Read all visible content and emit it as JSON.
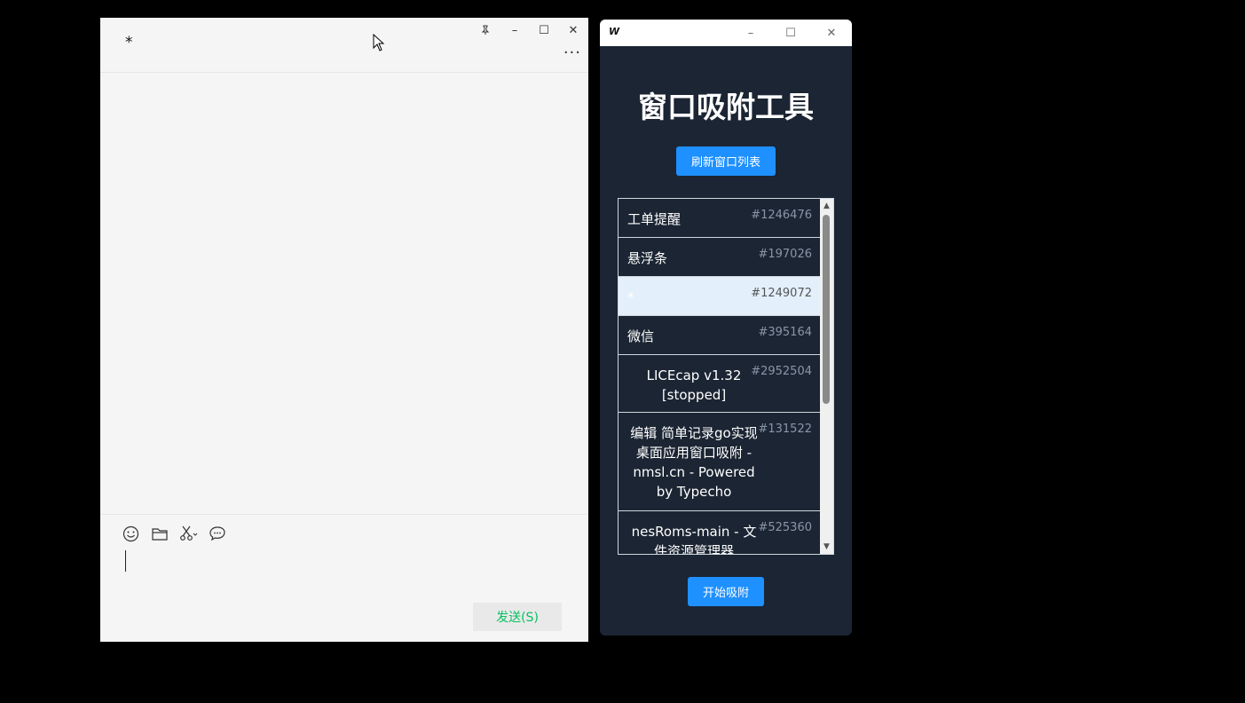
{
  "chat": {
    "title": "*",
    "controls": {
      "pin": "pin-icon",
      "minimize": "–",
      "maximize": "☐",
      "close": "✕",
      "more": "···"
    },
    "toolbar": {
      "emoji": "emoji-icon",
      "folder": "folder-icon",
      "screenshot": "scissors-icon",
      "chat_history": "chat-bubble-icon"
    },
    "send_label": "发送(S)",
    "send_color": "#07c160"
  },
  "tool": {
    "logo": "W",
    "controls": {
      "minimize": "–",
      "maximize": "☐",
      "close": "✕"
    },
    "heading": "窗口吸附工具",
    "refresh_label": "刷新窗口列表",
    "start_label": "开始吸附",
    "accent": "#1e90ff",
    "windows": [
      {
        "title": "工单提醒",
        "id": "#1246476"
      },
      {
        "title": "悬浮条",
        "id": "#197026"
      },
      {
        "title": "*",
        "id": "#1249072",
        "selected": true
      },
      {
        "title": "微信",
        "id": "#395164"
      },
      {
        "title": "LICEcap v1.32 [stopped]",
        "id": "#2952504"
      },
      {
        "title": "编辑 简单记录go实现桌面应用窗口吸附 - nmsl.cn - Powered by Typecho",
        "id": "#131522"
      },
      {
        "title": "nesRoms-main - 文件资源管理器",
        "id": "#525360"
      }
    ]
  }
}
